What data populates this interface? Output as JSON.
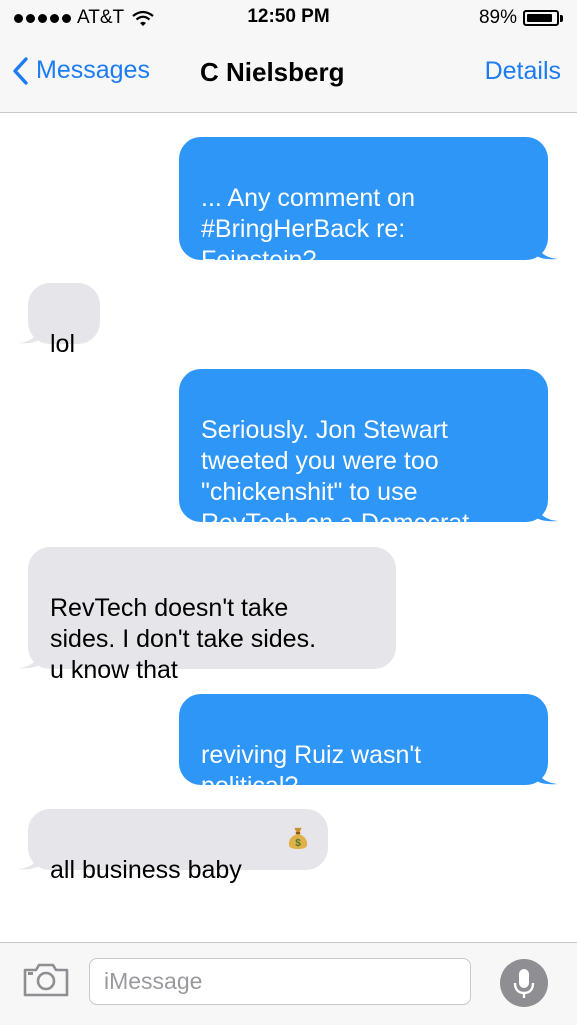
{
  "status_bar": {
    "carrier": "AT&T",
    "time": "12:50 PM",
    "battery_percent": "89%",
    "battery_level": 0.89,
    "icons": [
      "signal-dots-icon",
      "wifi-icon",
      "battery-icon"
    ]
  },
  "nav": {
    "back_label": "Messages",
    "title": "C Nielsberg",
    "details_label": "Details"
  },
  "messages": [
    {
      "from": "me",
      "text": "... Any comment on\n#BringHerBack re:\nFeinstein?"
    },
    {
      "from": "them",
      "text": "lol"
    },
    {
      "from": "me",
      "text": "Seriously. Jon Stewart\ntweeted you were too\n\"chickenshit\" to use\nRevTech on a Democrat."
    },
    {
      "from": "them",
      "text": "RevTech doesn't take\nsides. I don't take sides.\nu know that"
    },
    {
      "from": "me",
      "text": "reviving Ruiz wasn't\npolitical?"
    },
    {
      "from": "them",
      "text": "all business baby",
      "emoji": "money-bag-icon"
    }
  ],
  "composer": {
    "placeholder": "iMessage",
    "value": "",
    "icons": [
      "camera-icon",
      "microphone-icon"
    ]
  },
  "colors": {
    "sent_bubble": "#2d96f7",
    "received_bubble": "#e5e5ea",
    "accent": "#1c7cf2"
  }
}
